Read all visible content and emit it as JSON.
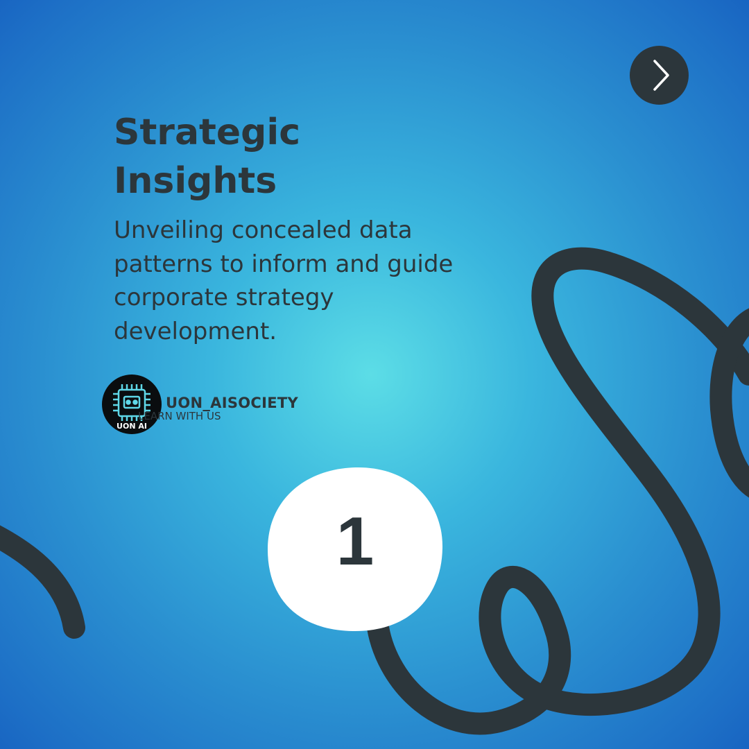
{
  "slide": {
    "title_line1": "Strategic",
    "title_line2": "Insights",
    "description": "Unveiling concealed data patterns to inform and guide corporate strategy development.",
    "number": "1"
  },
  "brand": {
    "name": "UON_AISOCIETY",
    "tagline": "LEARN WITH US",
    "logo_text": "UON AI"
  },
  "navigation": {
    "next_icon": "chevron-right-icon"
  },
  "colors": {
    "ink": "#2c363b",
    "background_center": "#5cdde6",
    "background_edge": "#0e4fb8",
    "blob": "#ffffff",
    "logo_bg": "#0a0d0f",
    "logo_accent": "#5fd8e8"
  }
}
